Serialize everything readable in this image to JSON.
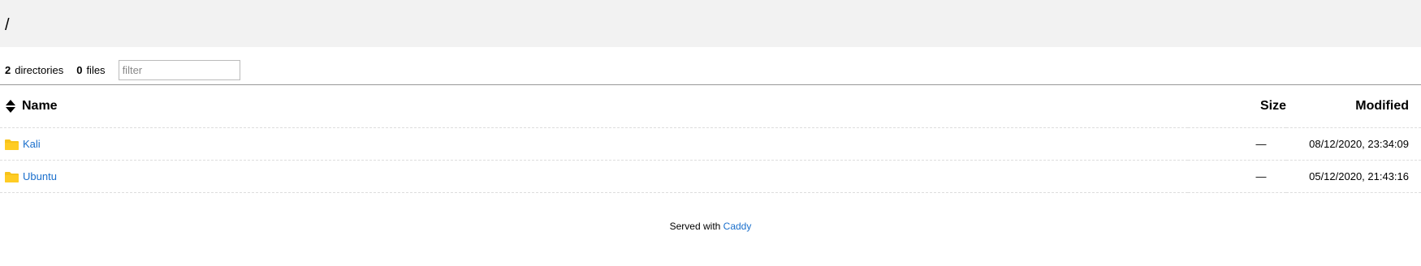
{
  "header": {
    "path": "/"
  },
  "meta": {
    "dir_count": "2",
    "dir_label": "directories",
    "file_count": "0",
    "file_label": "files",
    "filter_placeholder": "filter"
  },
  "table": {
    "columns": {
      "name": "Name",
      "size": "Size",
      "modified": "Modified"
    },
    "rows": [
      {
        "name": "Kali",
        "size": "—",
        "modified": "08/12/2020, 23:34:09",
        "icon": "folder-icon"
      },
      {
        "name": "Ubuntu",
        "size": "—",
        "modified": "05/12/2020, 21:43:16",
        "icon": "folder-icon"
      }
    ]
  },
  "footer": {
    "served_with": "Served with",
    "link": "Caddy"
  },
  "colors": {
    "link": "#1a6fcc",
    "folder": "#f7c31b",
    "header_bg": "#f2f2f2"
  }
}
